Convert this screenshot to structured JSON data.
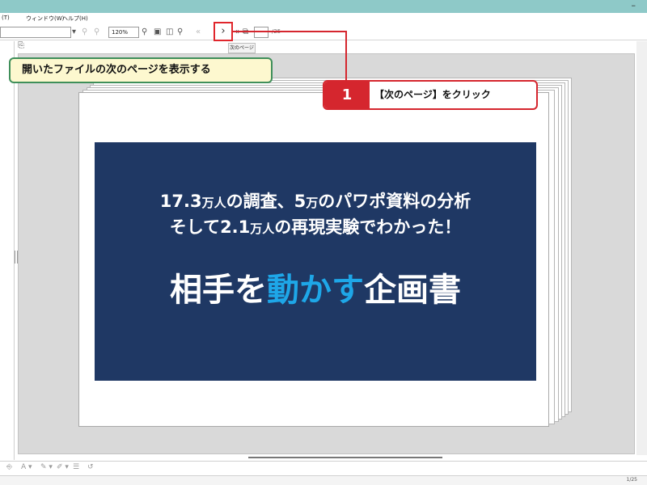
{
  "window": {
    "minimize_glyph": "–"
  },
  "menu": {
    "items": [
      "(T)",
      "ウィンドウ(W)",
      "ヘルプ(H)"
    ]
  },
  "toolbar": {
    "zoom_value": "120%",
    "next_glyph": "›",
    "prev_glyph": "«",
    "page_total": "/25",
    "tooltip": "次のページ"
  },
  "slide": {
    "line1_parts": [
      "17.3",
      "万人",
      "の調査、5",
      "万",
      "のパワポ資料の分析"
    ],
    "line2_parts": [
      "そして2.1",
      "万人",
      "の再現実験でわかった！"
    ],
    "title_pre": "相手を",
    "title_accent": "動かす",
    "title_post": "企画書"
  },
  "callouts": {
    "green_text": "開いたファイルの次のページを表示する",
    "step_number": "1",
    "step_text": "【次のページ】をクリック"
  },
  "status": {
    "page": "1/25"
  },
  "colors": {
    "titlebar": "#8ec9c8",
    "slide_bg": "#1f3864",
    "accent": "#1ea7e8",
    "callout_red": "#d5262e",
    "callout_green_border": "#3f8f5a",
    "callout_green_bg": "#fdf8cf"
  }
}
